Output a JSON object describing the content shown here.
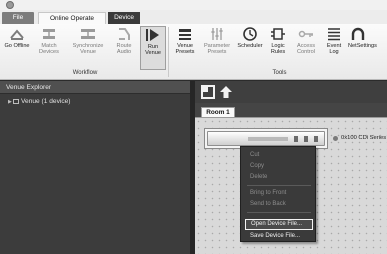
{
  "window": {
    "app_icon": "app-logo-icon"
  },
  "tabs": [
    {
      "label": "File",
      "name": "tab-file"
    },
    {
      "label": "Online Operate",
      "name": "tab-online-operate",
      "selected": true
    },
    {
      "label": "Device",
      "name": "tab-device"
    }
  ],
  "ribbon": {
    "workflow": {
      "group_label": "Workflow",
      "buttons": [
        {
          "label": "Go Offline",
          "icon": "go-offline-icon",
          "enabled": true
        },
        {
          "label": "Match Devices",
          "icon": "match-devices-icon",
          "enabled": false
        },
        {
          "label": "Synchronize Venue",
          "icon": "synchronize-venue-icon",
          "enabled": false
        },
        {
          "label": "Route Audio",
          "icon": "route-audio-icon",
          "enabled": false
        },
        {
          "label": "Run Venue",
          "icon": "run-venue-icon",
          "enabled": true,
          "selected": true
        }
      ]
    },
    "tools": {
      "group_label": "Tools",
      "buttons": [
        {
          "label": "Venue Presets",
          "icon": "venue-presets-icon",
          "enabled": true
        },
        {
          "label": "Parameter Presets",
          "icon": "parameter-presets-icon",
          "enabled": false
        },
        {
          "label": "Scheduler",
          "icon": "scheduler-icon",
          "enabled": true
        },
        {
          "label": "Logic Rules",
          "icon": "logic-rules-icon",
          "enabled": true
        },
        {
          "label": "Access Control",
          "icon": "access-control-icon",
          "enabled": false
        },
        {
          "label": "Event Log",
          "icon": "event-log-icon",
          "enabled": true
        },
        {
          "label": "NetSettings",
          "icon": "net-settings-icon",
          "enabled": true
        }
      ]
    }
  },
  "explorer": {
    "title": "Venue Explorer",
    "tree": [
      {
        "label": "Venue (1 device)",
        "icon": "venue-icon",
        "expand_icon": "expand-arrow-icon"
      }
    ]
  },
  "workspace": {
    "toolbar_icons": [
      "layout-icon",
      "up-arrow-icon"
    ],
    "room_tab": "Room 1",
    "device": {
      "name": "0x100 CDi Series",
      "image": "amplifier-device-icon",
      "status_icon": "status-dot-icon"
    }
  },
  "context_menu": {
    "items": [
      {
        "label": "Cut",
        "enabled": false
      },
      {
        "label": "Copy",
        "enabled": false
      },
      {
        "label": "Delete",
        "enabled": false
      },
      {
        "separator": true
      },
      {
        "label": "Bring to Front",
        "enabled": false
      },
      {
        "label": "Send to Back",
        "enabled": false
      },
      {
        "separator": true
      },
      {
        "label": "Open Device File...",
        "enabled": true,
        "highlighted": true
      },
      {
        "label": "Save Device File...",
        "enabled": true
      }
    ]
  },
  "colors": {
    "ribbon_bg": "#f2f2f2",
    "pane_dark": "#3c3c3c",
    "canvas_bg": "#d9d9d9",
    "menu_bg": "#3a3a3a",
    "highlight_border": "#f4f4f4"
  }
}
